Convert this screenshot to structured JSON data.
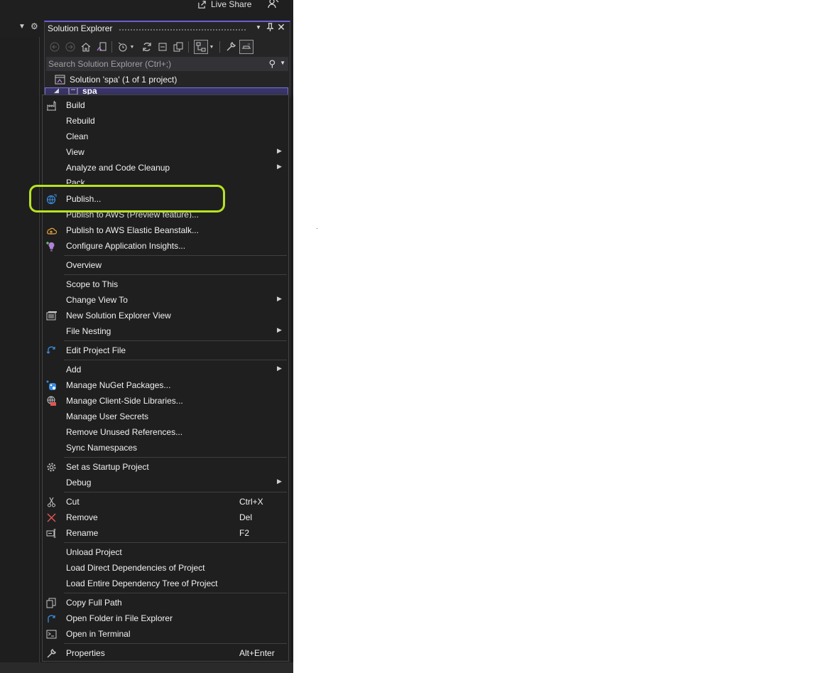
{
  "top_bar": {
    "live_share_label": "Live Share"
  },
  "solution_explorer": {
    "title": "Solution Explorer",
    "search_placeholder": "Search Solution Explorer (Ctrl+;)",
    "solution_node": "Solution 'spa' (1 of 1 project)",
    "project_node": "spa"
  },
  "context_menu": {
    "items": [
      {
        "label": "Build",
        "icon": "build-icon"
      },
      {
        "label": "Rebuild"
      },
      {
        "label": "Clean"
      },
      {
        "label": "View",
        "submenu": true
      },
      {
        "label": "Analyze and Code Cleanup",
        "submenu": true
      },
      {
        "label": "Pack"
      },
      {
        "label": "Publish...",
        "icon": "publish-globe-icon"
      },
      {
        "label": "Publish to AWS (Preview feature)..."
      },
      {
        "label": "Publish to AWS Elastic Beanstalk...",
        "icon": "aws-beanstalk-icon"
      },
      {
        "label": "Configure Application Insights...",
        "icon": "app-insights-icon"
      },
      {
        "label": "Overview"
      },
      {
        "label": "Scope to This"
      },
      {
        "label": "Change View To",
        "submenu": true
      },
      {
        "label": "New Solution Explorer View",
        "icon": "new-view-icon"
      },
      {
        "label": "File Nesting",
        "submenu": true
      },
      {
        "label": "Edit Project File",
        "icon": "edit-project-icon"
      },
      {
        "label": "Add",
        "submenu": true
      },
      {
        "label": "Manage NuGet Packages...",
        "icon": "nuget-icon"
      },
      {
        "label": "Manage Client-Side Libraries...",
        "icon": "client-libraries-icon"
      },
      {
        "label": "Manage User Secrets"
      },
      {
        "label": "Remove Unused References..."
      },
      {
        "label": "Sync Namespaces"
      },
      {
        "label": "Set as Startup Project",
        "icon": "gear-icon"
      },
      {
        "label": "Debug",
        "submenu": true
      },
      {
        "label": "Cut",
        "shortcut": "Ctrl+X",
        "icon": "scissors-icon"
      },
      {
        "label": "Remove",
        "shortcut": "Del",
        "icon": "remove-x-icon"
      },
      {
        "label": "Rename",
        "shortcut": "F2",
        "icon": "rename-icon"
      },
      {
        "label": "Unload Project"
      },
      {
        "label": "Load Direct Dependencies of Project"
      },
      {
        "label": "Load Entire Dependency Tree of Project"
      },
      {
        "label": "Copy Full Path",
        "icon": "copy-icon"
      },
      {
        "label": "Open Folder in File Explorer",
        "icon": "open-folder-icon"
      },
      {
        "label": "Open in Terminal",
        "icon": "terminal-icon"
      },
      {
        "label": "Properties",
        "shortcut": "Alt+Enter",
        "icon": "wrench-icon"
      }
    ]
  },
  "colors": {
    "highlight": "#b6e321",
    "panel_bg": "#252526",
    "menu_bg": "#1f1f1f",
    "accent": "#6b5fd6"
  }
}
